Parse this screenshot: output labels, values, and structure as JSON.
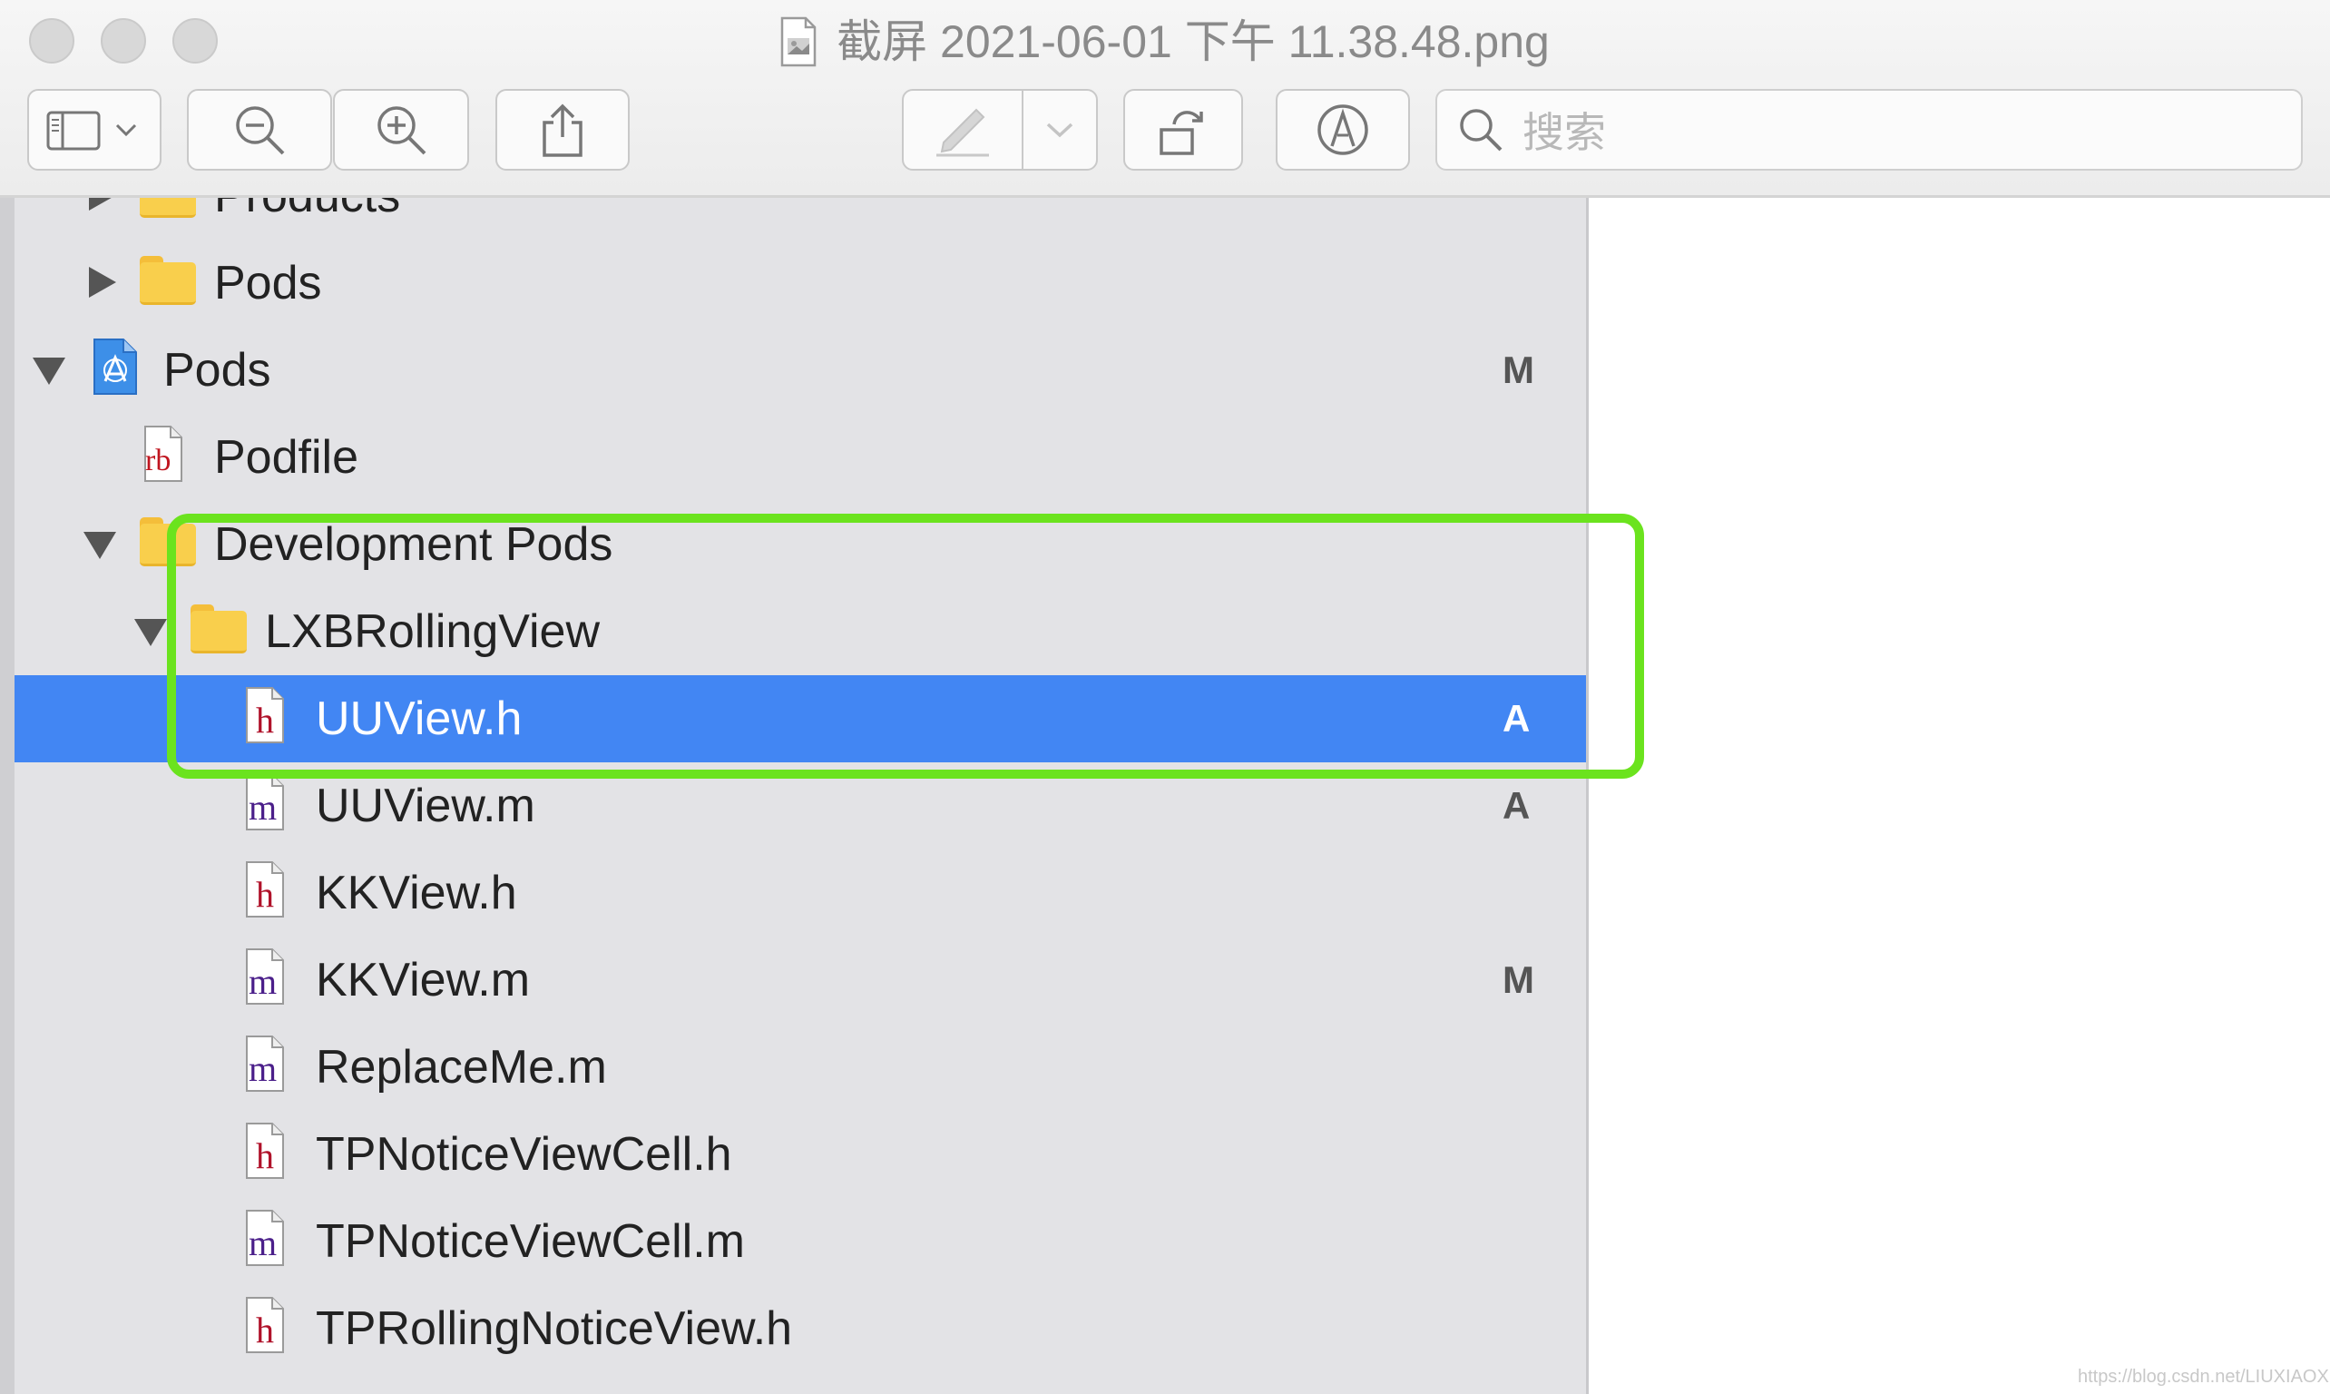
{
  "window": {
    "title": "截屏 2021-06-01 下午 11.38.48.png",
    "title_icon": "image-file-icon"
  },
  "toolbar": {
    "buttons": [
      {
        "name": "sidebar-toggle-button",
        "icon": "sidebar-icon"
      },
      {
        "name": "zoom-out-button",
        "icon": "zoom-out-icon"
      },
      {
        "name": "zoom-in-button",
        "icon": "zoom-in-icon"
      },
      {
        "name": "share-button",
        "icon": "share-icon"
      },
      {
        "name": "markup-button",
        "icon": "pen-icon"
      },
      {
        "name": "rotate-button",
        "icon": "rotate-icon"
      },
      {
        "name": "annotate-button",
        "icon": "markup-icon"
      }
    ],
    "search_placeholder": "搜索"
  },
  "navigator": {
    "rows": [
      {
        "label": "Products",
        "type": "folder",
        "disclosure": "collapsed",
        "badge": ""
      },
      {
        "label": "Pods",
        "type": "folder",
        "disclosure": "collapsed",
        "badge": ""
      },
      {
        "label": "Pods",
        "type": "project",
        "disclosure": "expanded",
        "badge": "M"
      },
      {
        "label": "Podfile",
        "type": "ruby-file",
        "glyph": "rb",
        "badge": ""
      },
      {
        "label": "Development Pods",
        "type": "folder",
        "disclosure": "expanded",
        "badge": ""
      },
      {
        "label": "LXBRollingView",
        "type": "folder",
        "disclosure": "expanded",
        "badge": ""
      },
      {
        "label": "UUView.h",
        "type": "header-file",
        "glyph": "h",
        "badge": "A",
        "selected": true
      },
      {
        "label": "UUView.m",
        "type": "source-file",
        "glyph": "m",
        "badge": "A"
      },
      {
        "label": "KKView.h",
        "type": "header-file",
        "glyph": "h",
        "badge": ""
      },
      {
        "label": "KKView.m",
        "type": "source-file",
        "glyph": "m",
        "badge": "M"
      },
      {
        "label": "ReplaceMe.m",
        "type": "source-file",
        "glyph": "m",
        "badge": ""
      },
      {
        "label": "TPNoticeViewCell.h",
        "type": "header-file",
        "glyph": "h",
        "badge": ""
      },
      {
        "label": "TPNoticeViewCell.m",
        "type": "source-file",
        "glyph": "m",
        "badge": ""
      },
      {
        "label": "TPRollingNoticeView.h",
        "type": "header-file",
        "glyph": "h",
        "badge": ""
      }
    ]
  },
  "colors": {
    "selection": "#4286f3",
    "highlight": "#6be31e",
    "header_glyph": "#b0122a",
    "source_glyph": "#4b1f8a"
  },
  "watermark": "https://blog.csdn.net/LIUXIAOXIAOBG"
}
